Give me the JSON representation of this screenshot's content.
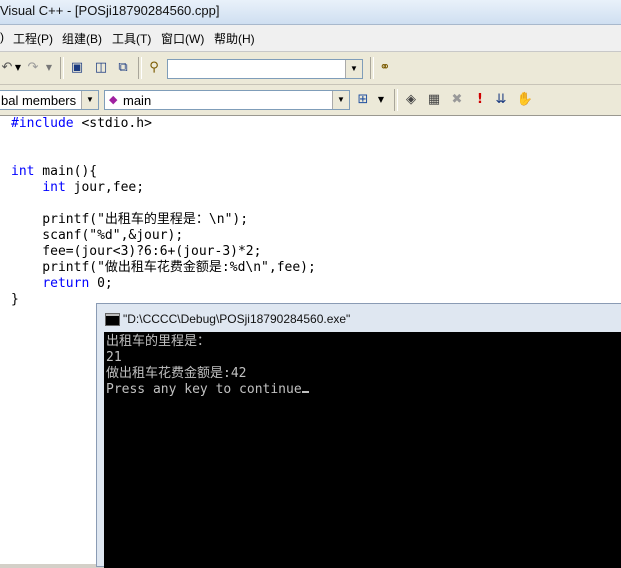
{
  "window": {
    "title": "Visual C++ - [POSji18790284560.cpp]"
  },
  "menu": {
    "items": [
      ")",
      "工程(P)",
      "组建(B)",
      "工具(T)",
      "窗口(W)",
      "帮助(H)"
    ]
  },
  "toolbar": {
    "find_combo_value": "",
    "members_combo": "bal members",
    "function_combo": "main"
  },
  "code": {
    "lines": [
      "#include <stdio.h>",
      "",
      "",
      "int main(){",
      "    int jour,fee;",
      "",
      "    printf(\"出租车的里程是：\\n\");",
      "    scanf(\"%d\",&jour);",
      "    fee=(jour<3)?6:6+(jour-3)*2;",
      "    printf(\"做出租车花费金额是:%d\\n\",fee);",
      "    return 0;",
      "}"
    ]
  },
  "console": {
    "title": "\"D:\\CCCC\\Debug\\POSji18790284560.exe\"",
    "lines": [
      "出租车的里程是：",
      "21",
      "做出租车花费金额是:42",
      "Press any key to continue"
    ]
  },
  "colors": {
    "keyword": "#0000ff",
    "console_bg": "#000000",
    "console_text": "#c0c0c0"
  }
}
